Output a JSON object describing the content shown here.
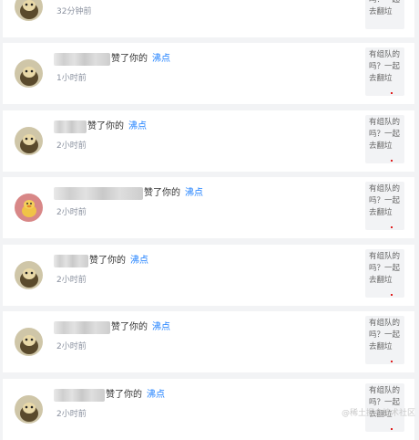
{
  "colors": {
    "background": "#f2f3f5",
    "card": "#ffffff",
    "link": "#1e80ff",
    "time": "#8a919f"
  },
  "notifications": [
    {
      "avatar": "cat-avatar",
      "action": "",
      "target": "",
      "time": "32分钟前",
      "preview": "有组队的吗？一起去翻垃"
    },
    {
      "avatar": "cat-avatar",
      "action": "赞了你的",
      "target": "沸点",
      "time": "1小时前",
      "preview": "有组队的吗？一起去翻垃"
    },
    {
      "avatar": "cat-avatar",
      "action": "赞了你的",
      "target": "沸点",
      "time": "2小时前",
      "preview": "有组队的吗？一起去翻垃"
    },
    {
      "avatar": "duck-avatar",
      "action": "赞了你的",
      "target": "沸点",
      "time": "2小时前",
      "preview": "有组队的吗？一起去翻垃"
    },
    {
      "avatar": "cat-avatar",
      "action": "赞了你的",
      "target": "沸点",
      "time": "2小时前",
      "preview": "有组队的吗？一起去翻垃"
    },
    {
      "avatar": "cat-avatar",
      "action": "赞了你的",
      "target": "沸点",
      "time": "2小时前",
      "preview": "有组队的吗？一起去翻垃"
    },
    {
      "avatar": "cat-avatar",
      "action": "赞了你的",
      "target": "沸点",
      "time": "2小时前",
      "preview": "有组队的吗？一起去翻垃"
    }
  ],
  "watermark": "@稀土掘金技术社区"
}
